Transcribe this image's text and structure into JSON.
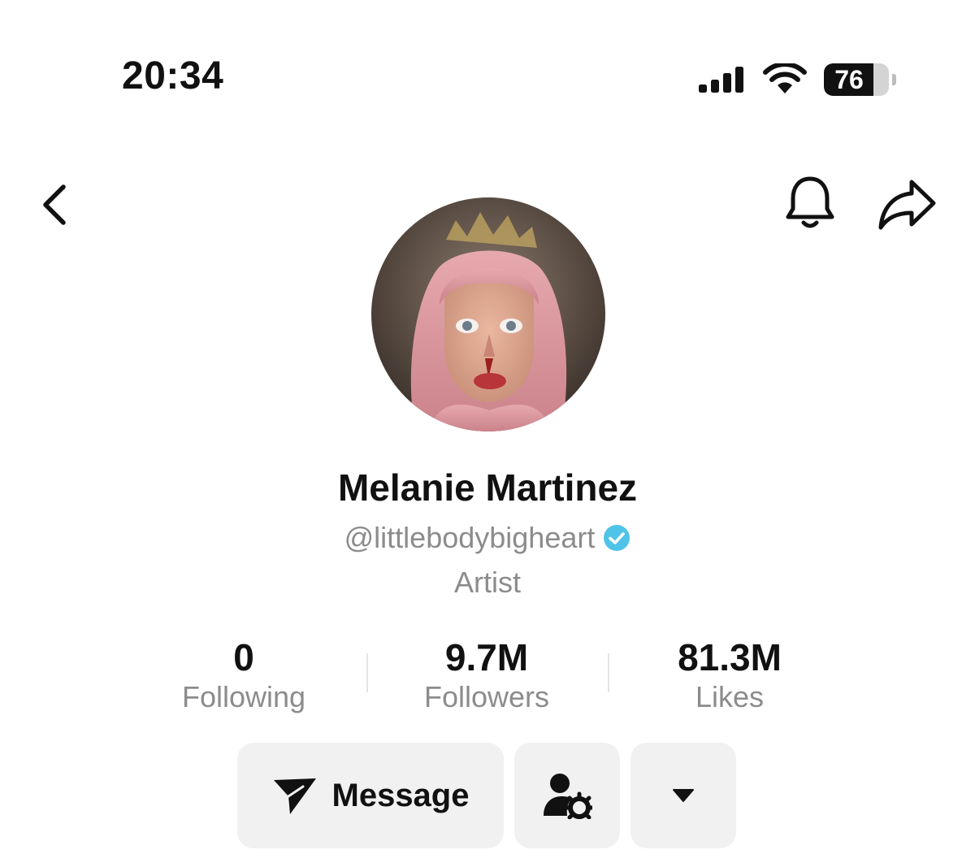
{
  "status_bar": {
    "time": "20:34",
    "battery_percent": "76",
    "battery_level": 0.76,
    "icons": [
      "cellular-signal-icon",
      "wifi-icon",
      "battery-icon"
    ]
  },
  "nav": {
    "icons": [
      "chevron-left-icon",
      "bell-icon",
      "share-icon"
    ]
  },
  "profile": {
    "display_name": "Melanie Martinez",
    "handle": "@littlebodybigheart",
    "verified": true,
    "bio": "Artist"
  },
  "stats": [
    {
      "value": "0",
      "label": "Following"
    },
    {
      "value": "9.7M",
      "label": "Followers"
    },
    {
      "value": "81.3M",
      "label": "Likes"
    }
  ],
  "actions": {
    "message_label": "Message",
    "friends_icon": "user-settings-icon",
    "more_icon": "caret-down-icon"
  },
  "colors": {
    "text_primary": "#111111",
    "text_secondary": "#8c8c8c",
    "verified_badge": "#4fc3e8",
    "button_bg": "#f1f1f1"
  }
}
